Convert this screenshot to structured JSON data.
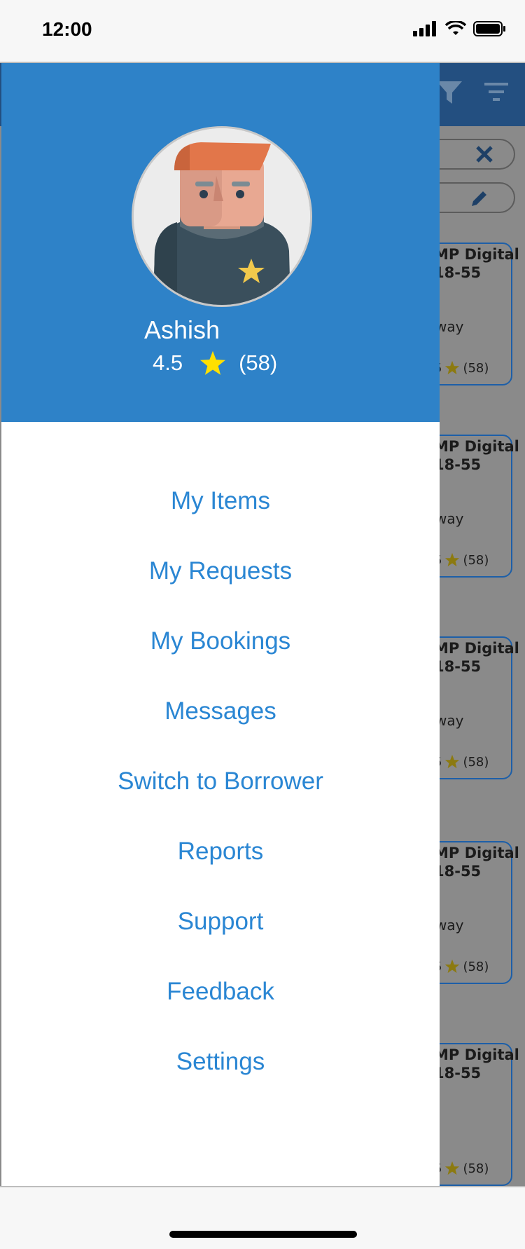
{
  "status_bar": {
    "time": "12:00"
  },
  "drawer": {
    "user_name": "Ashish",
    "rating_value": "4.5",
    "rating_count": "(58)",
    "menu": [
      {
        "label": "My Items",
        "name": "menu-item-my-items"
      },
      {
        "label": "My Requests",
        "name": "menu-item-my-requests"
      },
      {
        "label": "My Bookings",
        "name": "menu-item-my-bookings"
      },
      {
        "label": "Messages",
        "name": "menu-item-messages"
      },
      {
        "label": "Switch to Borrower",
        "name": "menu-item-switch-to-borrower"
      },
      {
        "label": "Reports",
        "name": "menu-item-reports"
      },
      {
        "label": "Support",
        "name": "menu-item-support"
      },
      {
        "label": "Feedback",
        "name": "menu-item-feedback"
      },
      {
        "label": "Settings",
        "name": "menu-item-settings"
      }
    ]
  },
  "background": {
    "cards": [
      {
        "title": "MP Digital 18-55",
        "subtitle": "way",
        "rating": "5",
        "count": "(58)"
      },
      {
        "title": "MP Digital 18-55",
        "subtitle": "way",
        "rating": "5",
        "count": "(58)"
      },
      {
        "title": "MP Digital 18-55",
        "subtitle": "way",
        "rating": "5",
        "count": "(58)"
      },
      {
        "title": "MP Digital 18-55",
        "subtitle": "way",
        "rating": "5",
        "count": "(58)"
      },
      {
        "title": "MP Digital 18-55",
        "subtitle": "",
        "rating": "5",
        "count": "(58)"
      }
    ]
  },
  "colors": {
    "accent": "#2e82c8",
    "menu_text": "#2a86d3",
    "star": "#ffe000"
  },
  "icons": [
    "filter-icon",
    "sort-icon",
    "close-icon",
    "edit-icon",
    "star-icon",
    "signal-icon",
    "wifi-icon",
    "battery-icon"
  ]
}
